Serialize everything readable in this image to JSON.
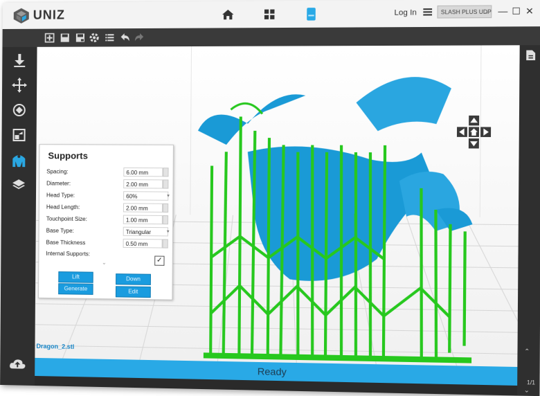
{
  "app": {
    "brand": "UNIZ"
  },
  "header": {
    "login": "Log In",
    "printer": "SLASH PLUS UDP",
    "nav": [
      {
        "icon": "home-icon"
      },
      {
        "icon": "grid-icon"
      },
      {
        "icon": "printer-device-icon"
      }
    ]
  },
  "toolbar": {
    "icons": [
      "add-model-icon",
      "save-icon",
      "save-as-icon",
      "settings-icon",
      "list-icon",
      "undo-icon",
      "redo-icon"
    ]
  },
  "leftbar": {
    "icons": [
      "download-icon",
      "move-icon",
      "rotate-icon",
      "scale-icon",
      "supports-icon",
      "layers-icon"
    ]
  },
  "supports": {
    "title": "Supports",
    "fields": [
      {
        "label": "Spacing:",
        "value": "6.00 mm"
      },
      {
        "label": "Diameter:",
        "value": "2.00 mm"
      },
      {
        "label": "Head Type:",
        "value": "60%"
      },
      {
        "label": "Head Length:",
        "value": "2.00 mm"
      },
      {
        "label": "Touchpoint Size:",
        "value": "1.00 mm"
      },
      {
        "label": "Base Type:",
        "value": "Triangular"
      },
      {
        "label": "Base Thickness",
        "value": "0.50 mm"
      },
      {
        "label": "Internal Supports:",
        "value": "✓"
      }
    ],
    "buttons": {
      "lift": "Lift",
      "down": "Down",
      "generate": "Generate",
      "edit": "Edit"
    }
  },
  "file_name": "Dragon_2.stl",
  "status": "Ready",
  "pager": "1/1",
  "colors": {
    "accent": "#29a9e6",
    "support": "#27c81e",
    "model": "#1a9ad6"
  }
}
